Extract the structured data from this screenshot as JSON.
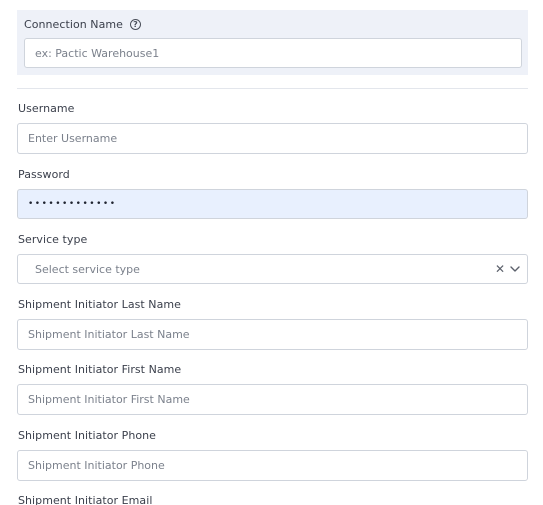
{
  "connection": {
    "label": "Connection Name",
    "help_icon": "help-circle-icon",
    "placeholder": "ex: Pactic Warehouse1"
  },
  "fields": {
    "username": {
      "label": "Username",
      "placeholder": "Enter Username"
    },
    "password": {
      "label": "Password",
      "value": "•••••••••••••"
    },
    "service_type": {
      "label": "Service type",
      "placeholder": "Select service type",
      "clear_icon": "close-icon",
      "dropdown_icon": "chevron-down-icon"
    },
    "initiator_last_name": {
      "label": "Shipment Initiator Last Name",
      "placeholder": "Shipment Initiator Last Name"
    },
    "initiator_first_name": {
      "label": "Shipment Initiator First Name",
      "placeholder": "Shipment Initiator First Name"
    },
    "initiator_phone": {
      "label": "Shipment Initiator Phone",
      "placeholder": "Shipment Initiator Phone"
    },
    "initiator_email": {
      "label": "Shipment Initiator Email"
    }
  },
  "colors": {
    "section_bg": "#eef1f8",
    "autofill_bg": "#e8f0fe",
    "border": "#cfd4dc"
  }
}
